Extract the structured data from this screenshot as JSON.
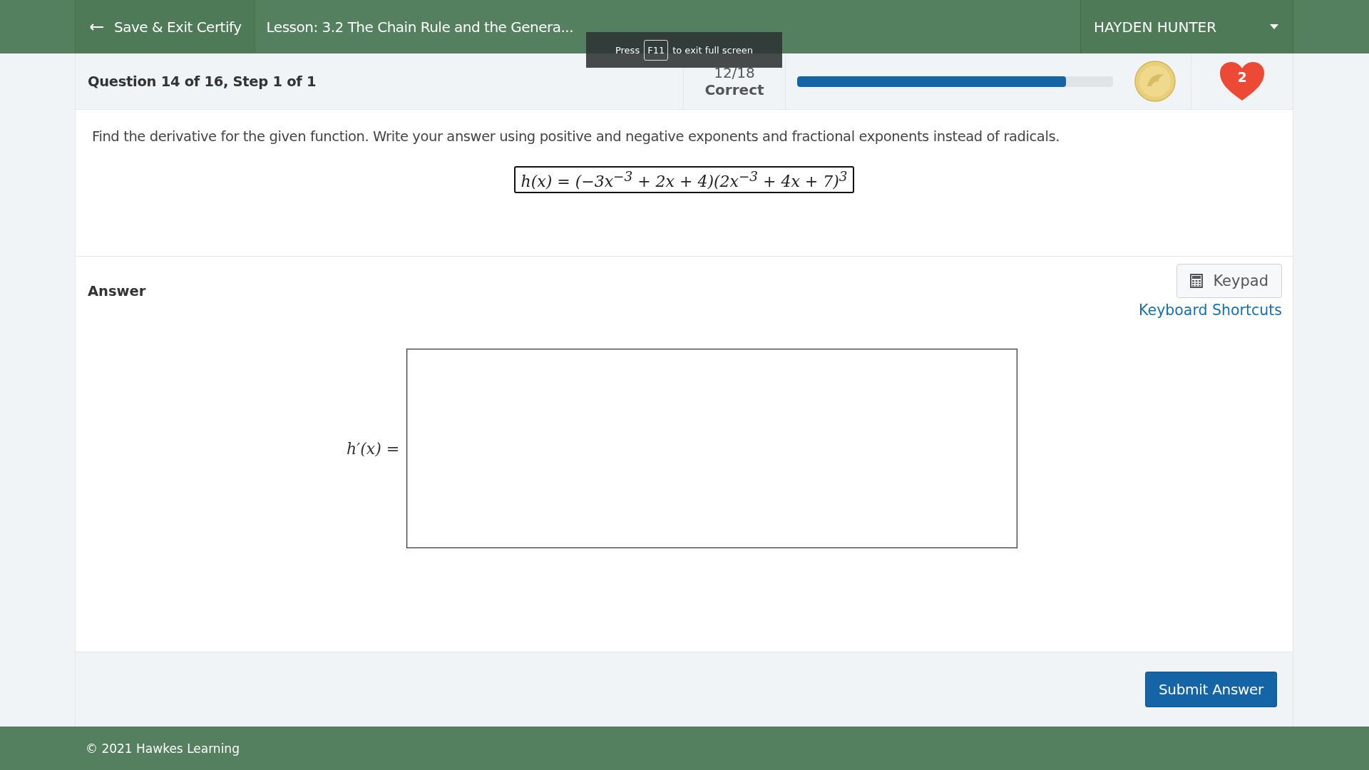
{
  "header": {
    "back_button": "Save & Exit Certify",
    "lesson_title": "Lesson: 3.2 The Chain Rule and the Genera...",
    "user_menu": "HAYDEN HUNTER"
  },
  "fullscreen_notice": {
    "before": "Press",
    "key": "F11",
    "after": "to exit full screen"
  },
  "question_bar": {
    "title": "Question 14 of 16, Step 1 of 1",
    "score": "12/18",
    "score_label": "Correct",
    "progress": {
      "level": 0.85
    },
    "lives": "2"
  },
  "problem": {
    "instructions": "Find the derivative for the given function. Write your answer using positive and negative exponents and fractional exponents instead of radicals.",
    "formula": "h(x) = (−3x$^{−3}$ + 2x + 4)(2x$^{−3}$ + 4x + 7)$^{3}$"
  },
  "answer": {
    "heading": "Answer",
    "keypad_button": "Keypad",
    "shortcuts_link": "Keyboard Shortcuts",
    "field_label": "h′(x) ="
  },
  "submit_button": "Submit Answer",
  "footer": "© 2021 Hawkes Learning"
}
